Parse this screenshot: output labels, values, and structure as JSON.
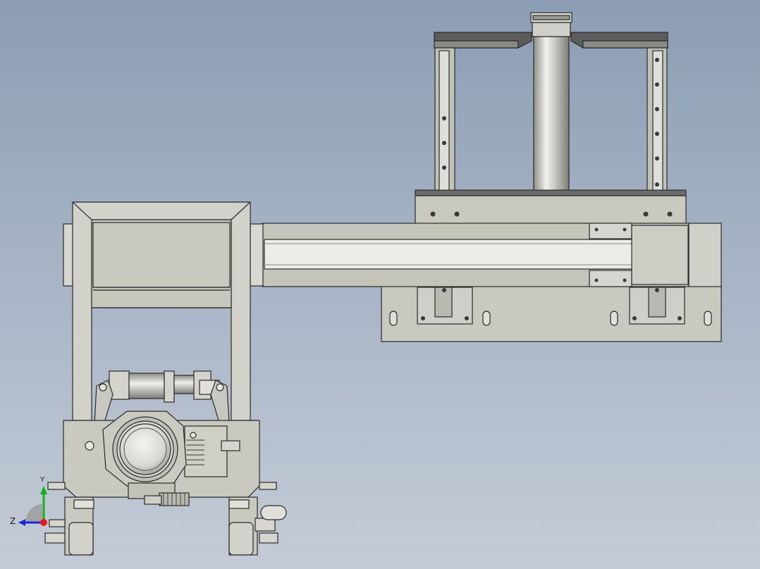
{
  "viewport": {
    "background_top": "#8b9db4",
    "background_bottom": "#c4cbd6"
  },
  "part_colors": {
    "metal": "#c7c7bd",
    "metal_dark": "#a9a9a0",
    "metal_light": "#e6e6df",
    "edge": "#2a2a2a",
    "plate_top": "#5a5a5a"
  },
  "triad": {
    "z_label": "Z",
    "y_label": "Y",
    "x_color": "#e8161b",
    "y_color": "#12b01e",
    "z_color": "#1a2ad6"
  }
}
